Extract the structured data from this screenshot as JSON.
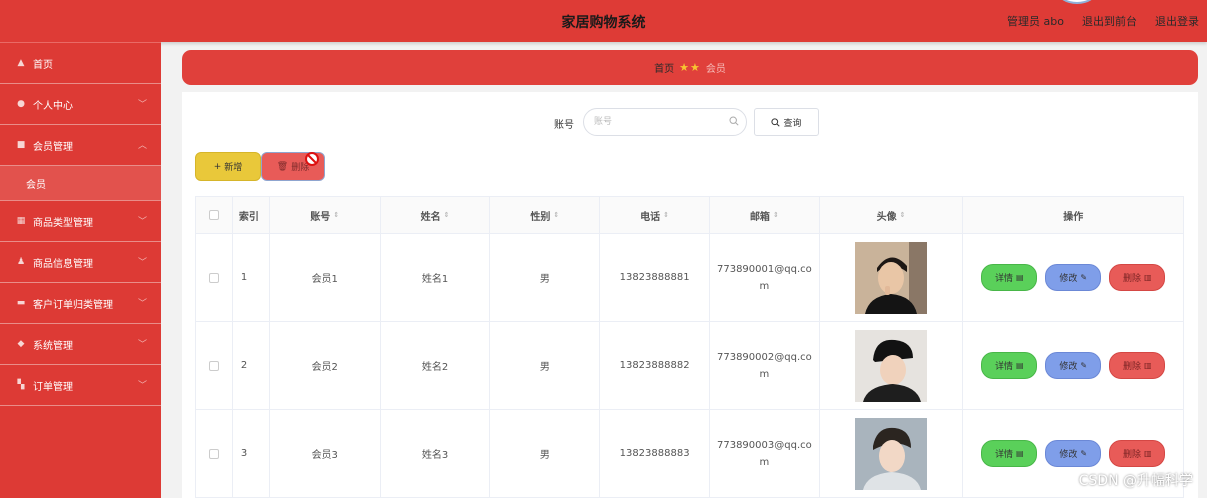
{
  "header": {
    "title": "家居购物系统",
    "admin_label": "管理员 abo",
    "back_front": "退出到前台",
    "logout": "退出登录"
  },
  "sidebar": {
    "items": [
      {
        "label": "首页",
        "icon": "home-icon",
        "expandable": false
      },
      {
        "label": "个人中心",
        "icon": "user-icon",
        "expandable": true
      },
      {
        "label": "会员管理",
        "icon": "members-icon",
        "expandable": true,
        "expanded": true
      },
      {
        "label": "商品类型管理",
        "icon": "category-icon",
        "expandable": true
      },
      {
        "label": "商品信息管理",
        "icon": "goods-icon",
        "expandable": true
      },
      {
        "label": "客户订单归类管理",
        "icon": "order-category-icon",
        "expandable": true
      },
      {
        "label": "系统管理",
        "icon": "system-icon",
        "expandable": true
      },
      {
        "label": "订单管理",
        "icon": "grid-icon",
        "expandable": true
      }
    ],
    "sub_item": "会员"
  },
  "breadcrumb": {
    "home": "首页",
    "current": "会员"
  },
  "search": {
    "label": "账号",
    "placeholder": "账号",
    "value": "",
    "button": "查询"
  },
  "toolbar": {
    "add": "新增",
    "delete": "删除"
  },
  "table": {
    "headers": [
      "索引",
      "账号",
      "姓名",
      "性别",
      "电话",
      "邮箱",
      "头像",
      "操作"
    ],
    "rows": [
      {
        "index": "1",
        "account": "会员1",
        "name": "姓名1",
        "gender": "男",
        "phone": "13823888881",
        "email": "773890001@qq.com"
      },
      {
        "index": "2",
        "account": "会员2",
        "name": "姓名2",
        "gender": "男",
        "phone": "13823888882",
        "email": "773890002@qq.com"
      },
      {
        "index": "3",
        "account": "会员3",
        "name": "姓名3",
        "gender": "男",
        "phone": "13823888883",
        "email": "773890003@qq.com"
      }
    ],
    "actions": {
      "detail": "详情",
      "edit": "修改",
      "delete": "删除"
    }
  },
  "watermark": "CSDN @升幅科学",
  "colors": {
    "primary": "#de3b36",
    "add_button": "#e9c83a",
    "detail_button": "#5ad05a",
    "edit_button": "#7f9ee9",
    "delete_button": "#e85b58"
  }
}
